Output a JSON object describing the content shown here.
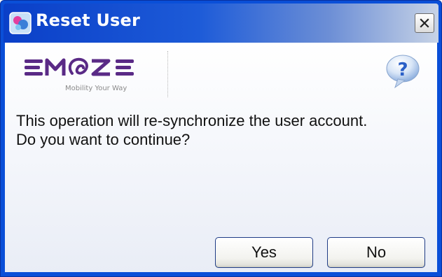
{
  "window": {
    "title": "Reset User",
    "close_symbol": "×"
  },
  "logo": {
    "brand": "EMOZE",
    "tagline": "Mobility Your Way"
  },
  "dialog": {
    "message_line1": "This operation will re-synchronize the user account.",
    "message_line2": "Do you want to continue?",
    "yes_label": "Yes",
    "no_label": "No"
  },
  "icons": {
    "title": "app-icon",
    "help": "question-icon",
    "close": "close-icon"
  },
  "colors": {
    "titlebar": "#0a3fc8",
    "window_border": "#0a4fd8",
    "brand_purple": "#5a2a86",
    "help_blue": "#2a5fc7"
  }
}
